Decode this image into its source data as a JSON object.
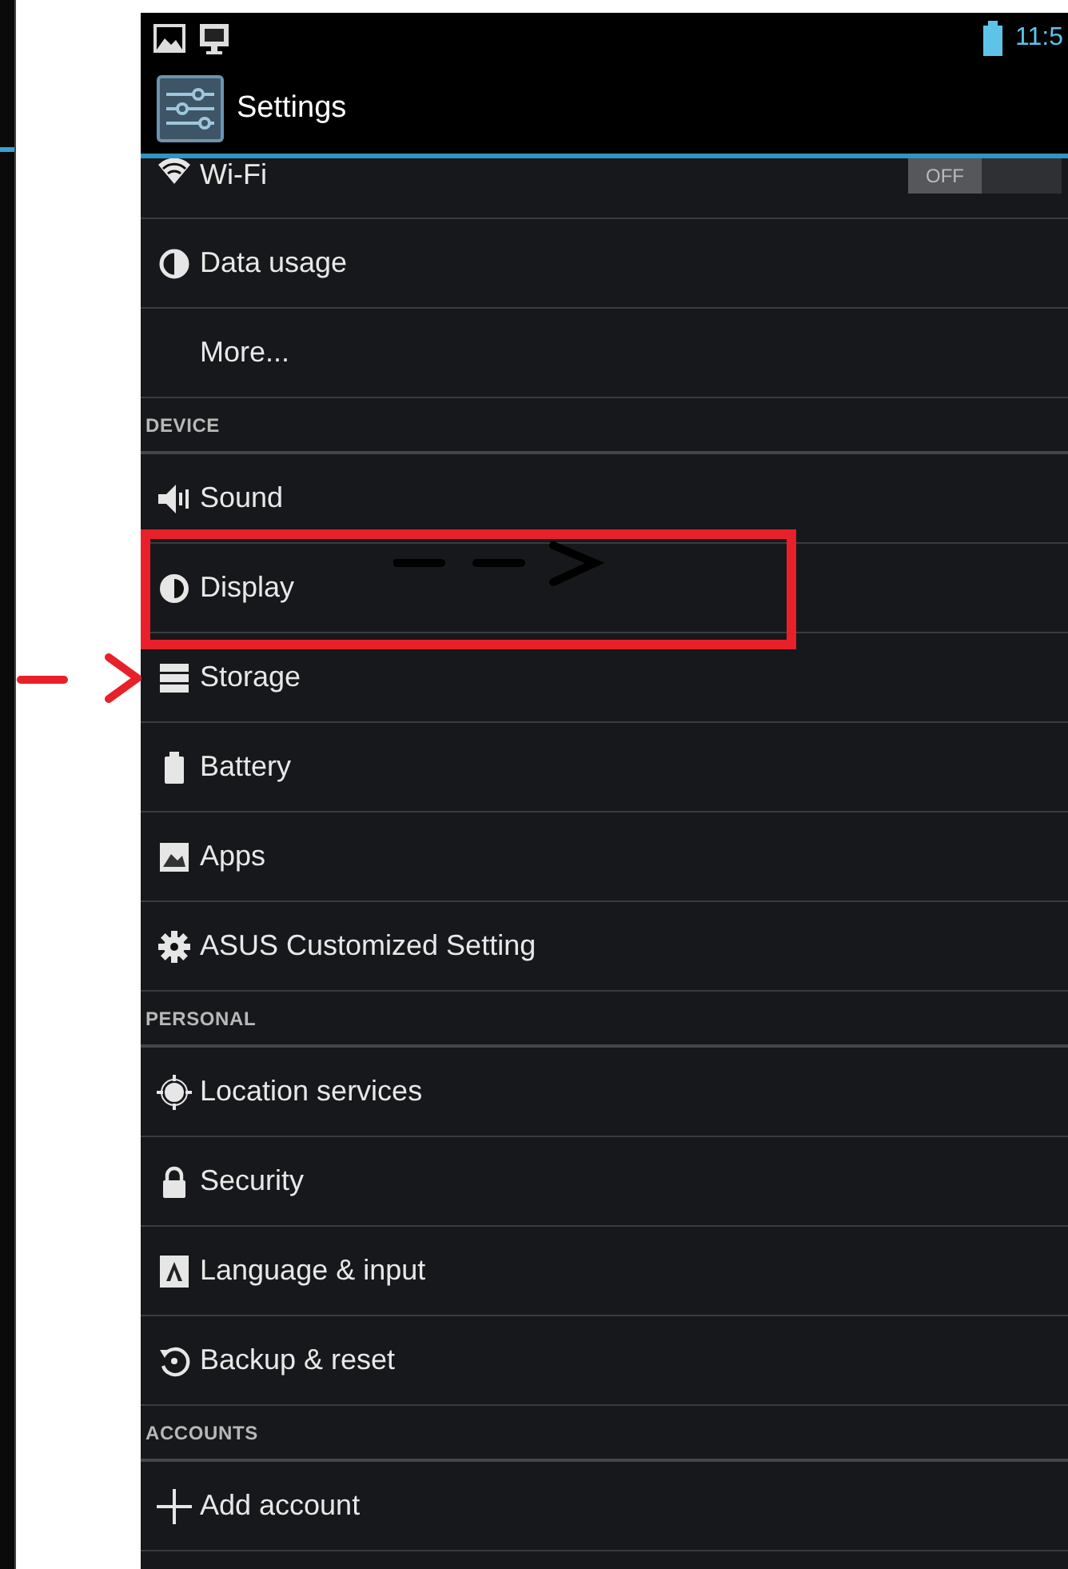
{
  "status_bar": {
    "time": "11:5"
  },
  "action_bar": {
    "title": "Settings"
  },
  "list": [
    {
      "kind": "toggle",
      "label": "Wi-Fi",
      "toggle_label": "OFF",
      "on": false
    },
    {
      "kind": "item",
      "label": "Data usage"
    },
    {
      "kind": "item",
      "label": "More..."
    },
    {
      "kind": "header",
      "label": "DEVICE"
    },
    {
      "kind": "item",
      "label": "Sound"
    },
    {
      "kind": "item",
      "label": "Display"
    },
    {
      "kind": "item",
      "label": "Storage"
    },
    {
      "kind": "item",
      "label": "Battery"
    },
    {
      "kind": "item",
      "label": "Apps"
    },
    {
      "kind": "item",
      "label": "ASUS Customized Setting"
    },
    {
      "kind": "header",
      "label": "PERSONAL"
    },
    {
      "kind": "item",
      "label": "Location services"
    },
    {
      "kind": "item",
      "label": "Security"
    },
    {
      "kind": "item",
      "label": "Language & input"
    },
    {
      "kind": "item",
      "label": "Backup & reset"
    },
    {
      "kind": "header",
      "label": "ACCOUNTS"
    },
    {
      "kind": "item",
      "label": "Add account"
    }
  ],
  "annotations": [
    {
      "kind": "box",
      "color": "#e8202a"
    },
    {
      "kind": "arrow",
      "color": "#000000"
    },
    {
      "kind": "arrow",
      "color": "#e8202a"
    }
  ]
}
